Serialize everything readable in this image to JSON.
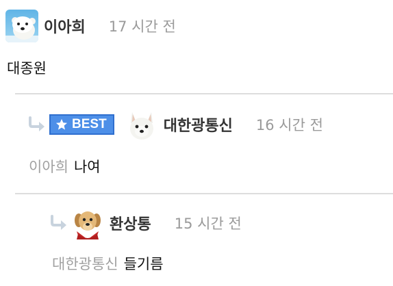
{
  "comments": [
    {
      "username": "이아희",
      "timestamp": "17 시간 전",
      "text": "대종원",
      "avatar": "polar-bear-icon"
    },
    {
      "badge": "BEST",
      "username": "대한광통신",
      "timestamp": "16 시간 전",
      "mention": "이아희",
      "text": "나여",
      "avatar": "white-dog-icon"
    },
    {
      "username": "환상통",
      "timestamp": "15 시간 전",
      "mention": "대한광통신",
      "text": "들기름",
      "avatar": "puppy-icon"
    }
  ],
  "colors": {
    "best_badge": "#4d8fe8",
    "reply_arrow": "#c8d3de",
    "timestamp": "#9a9a9a",
    "divider": "#dddddd"
  }
}
